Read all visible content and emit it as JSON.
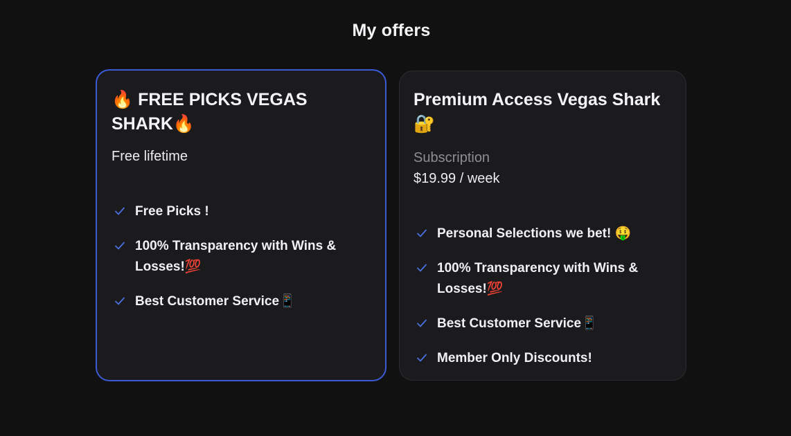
{
  "page": {
    "title": "My offers"
  },
  "offers": [
    {
      "title": "🔥 FREE PICKS VEGAS SHARK🔥",
      "subtitle": "Free lifetime",
      "features": [
        "Free Picks !",
        "100% Transparency with Wins & Losses!💯",
        "Best Customer Service📱"
      ],
      "selected": true
    },
    {
      "title": "Premium Access Vegas Shark 🔐",
      "subtitle": "Subscription",
      "price": "$19.99 / week",
      "features": [
        "Personal Selections we bet! 🤑",
        "100% Transparency with Wins & Losses!💯",
        "Best Customer Service📱",
        "Member Only Discounts!"
      ],
      "selected": false
    }
  ],
  "colors": {
    "background": "#111112",
    "card": "#1b1b1d",
    "selected_border": "#3b5bd6",
    "check": "#4a6fe0",
    "muted_text": "#8e8e93"
  },
  "icons": {
    "feature_check": "check-icon"
  }
}
